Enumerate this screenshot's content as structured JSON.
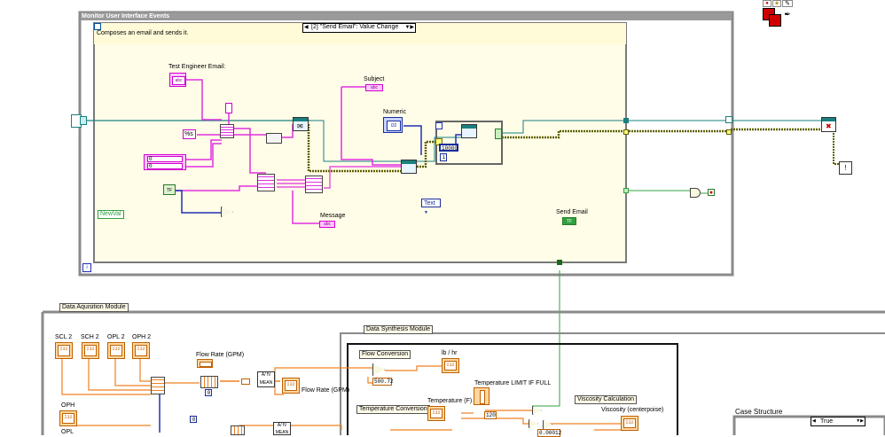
{
  "event_structure": {
    "title": "Monitor User Interface Events",
    "case_selector": "[2] \"Send Email\": Value Change",
    "comment": "Composes an email and sends it.",
    "newval_label": "NewVal",
    "test_engineer_label": "Test Engineer Email:",
    "subject_label": "Subject",
    "numeric_label": "Numeric",
    "message_label": "Message",
    "send_email_label": "Send Email",
    "format_string": "%s",
    "text_ring": "Text",
    "const_10000": "10000",
    "const_zero_a": "0",
    "const_zero_b": "0",
    "loop_index": "i",
    "cluster_index": "1",
    "abc_tag": "abc",
    "tf_tag": "TF",
    "num_tag": "I32"
  },
  "data_acquisition": {
    "title": "Data Aquisition Module",
    "channels": [
      "SCL 2",
      "SCH 2",
      "OPL 2",
      "OPH 2"
    ],
    "oph_label": "OPH",
    "opl_label": "OPL",
    "flow_rate_label": "Flow Rate (GPM)",
    "flow_rate_label_2": "Flow Rate (GPM)",
    "mean_label": "MEAN",
    "mean_label_2": "MEAN",
    "index_zero": "0",
    "index_zero_2": "0"
  },
  "data_synthesis": {
    "title": "Data Synthesis Module",
    "flow_conversion": "Flow Conversion",
    "lb_hr": "lb / hr",
    "const_500_72": "500.72",
    "temperature_conversion": "Temperature Conversion",
    "temperature_f": "Temperature (F)",
    "temp_limit": "Temperature LIMIT IF FULL",
    "const_120": "120",
    "viscosity_calc": "Viscosity Calculation",
    "viscosity_cp": "Viscosity (centerpoise)",
    "const_small": "0.00012"
  },
  "case_structure": {
    "title": "Case Structure",
    "selector": "True"
  },
  "colors": {
    "wire_pink": "#e030e0",
    "wire_orange": "#f08020",
    "wire_blue": "#2030b0",
    "wire_teal": "#1a8080",
    "wire_green": "#30a040",
    "structure_frame": "#8a8a8a"
  }
}
